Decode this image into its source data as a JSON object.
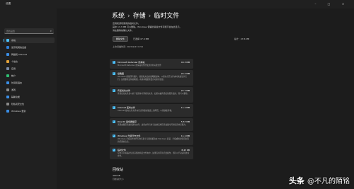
{
  "window": {
    "title": "设置",
    "controls": [
      "minimize-icon",
      "maximize-icon",
      "close-icon"
    ]
  },
  "sidebar": {
    "search_placeholder": "查找设置",
    "items": [
      {
        "label": "系统",
        "icon": "system-icon",
        "color": "#4cc2ff",
        "active": true
      },
      {
        "label": "蓝牙和其他设备",
        "icon": "bluetooth-icon",
        "color": "#2f7fd8"
      },
      {
        "label": "网络和 Internet",
        "icon": "network-icon",
        "color": "#3a8ee6"
      },
      {
        "label": "个性化",
        "icon": "brush-icon",
        "color": "#e3a33a"
      },
      {
        "label": "应用",
        "icon": "apps-icon",
        "color": "#7a8ba8"
      },
      {
        "label": "帐户",
        "icon": "account-icon",
        "color": "#2fbf71"
      },
      {
        "label": "时间和语言",
        "icon": "clock-globe-icon",
        "color": "#3a8ee6"
      },
      {
        "label": "游戏",
        "icon": "game-icon",
        "color": "#8a8a8a"
      },
      {
        "label": "辅助功能",
        "icon": "accessibility-icon",
        "color": "#3a8ee6"
      },
      {
        "label": "隐私和安全性",
        "icon": "shield-icon",
        "color": "#8a8a8a"
      },
      {
        "label": "Windows 更新",
        "icon": "update-icon",
        "color": "#3a8ee6"
      }
    ]
  },
  "main": {
    "breadcrumb": [
      "系统",
      "存储",
      "临时文件"
    ],
    "desc_lines": [
      "应用和游戏使用的临时文件。",
      "其中 13.3 MB 可以删除。Windows 保留的某些文件可能不会在此显示。",
      "请在删除前确认文件。"
    ],
    "remove_button": "删除文件",
    "selected_text": "已选择 47.6 MB",
    "total_text": "总计：47.6 MB",
    "scanned_text": "上次扫描时间: 2023/2/23 6:54",
    "items": [
      {
        "title": "Microsoft Defender 防病毒",
        "size": "43.3 MB",
        "desc": "Microsoft Defender 防病毒软件所使用的非关键文件"
      },
      {
        "title": "缩略图",
        "size": "24.2 MB",
        "desc": "Windows 保留所有图片、视频和文档的缩略图副本，以便在打开文件夹时快速显示它们。如果删除这些缩略图，系统将根据需要自动重新创建。"
      },
      {
        "title": "传递优化文件",
        "size": "27.7 MB",
        "desc": "传递优化文件是以前下载到你计算机的文件，如果未被传递优化服务使用，则可以删除。"
      },
      {
        "title": "Internet 临时文件",
        "size": "11.1 MB",
        "desc": "Internet 临时文件文件夹包含存储在硬盘上的网页，以便快速查看。"
      },
      {
        "title": "DirectX 着色器缓存",
        "size": "5.57 MB",
        "desc": "清理由图形系统创建的文件，这些文件可用于加快应用程序加载时间并提高响应能力。"
      },
      {
        "title": "Windows 升级日志文件",
        "size": "11.1 MB",
        "desc": "Windows 升级日志文件包含有助于识别和解决在 Windows 安装、升级或维护期间出现的问题的信息。"
      },
      {
        "title": "临时文件",
        "size": "8.43 KB",
        "desc": "应用可以将临时信息存储在特定文件夹中，如果应用不执行此操作，则可以手动清理这些文件。"
      }
    ],
    "recycle_heading": "回收站",
    "recycle_size": "400 KB",
    "recycle_label": "回收站的大小"
  },
  "watermark": {
    "brand": "头条",
    "handle": "@不凡的陌铭"
  }
}
